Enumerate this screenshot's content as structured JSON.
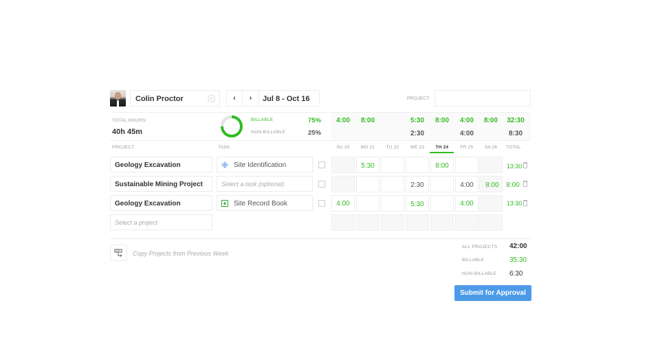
{
  "user": {
    "name": "Colin Proctor"
  },
  "date_range": {
    "label": "Jul 8 - Oct 16"
  },
  "project_filter": {
    "label": "PROJECT:",
    "value": ""
  },
  "summary": {
    "total_hours_label": "TOTAL HOURS:",
    "total_hours": "40h 45m",
    "billable_label": "BILLABLE",
    "billable_pct": "75%",
    "nonbillable_label": "NON-BILLABLE",
    "nonbillable_pct": "25%",
    "billable_fraction": 0.75,
    "billable_row": [
      "4:00",
      "8:00",
      "",
      "5:30",
      "8:00",
      "4:00",
      "8:00",
      "32:30"
    ],
    "nonbillable_row": [
      "",
      "",
      "",
      "2:30",
      "",
      "4:00",
      "",
      "8:30"
    ]
  },
  "columns": {
    "project": "PROJECT",
    "task": "TASK",
    "days": [
      "SU 20",
      "MO 21",
      "TU 22",
      "WE 23",
      "TH 24",
      "FR 25",
      "SA 26"
    ],
    "total": "TOTAL"
  },
  "rows": [
    {
      "project": "Geology Excavation",
      "task": "Site Identification",
      "task_icon": "diamond-icon",
      "hours": [
        "",
        "5:30",
        "",
        "",
        "8:00",
        "",
        ""
      ],
      "total": "13:30"
    },
    {
      "project": "Sustainable Mining Project",
      "task": "",
      "task_placeholder": "Select a task (optional)",
      "hours": [
        "",
        "",
        "",
        "2:30",
        "",
        "4:00",
        "8:00"
      ],
      "total": "8:00"
    },
    {
      "project": "Geology Excavation",
      "task": "Site Record Book",
      "task_icon": "star-box-icon",
      "hours": [
        "4:00",
        "",
        "",
        "5:30",
        "",
        "4:00",
        ""
      ],
      "total": "13:30"
    }
  ],
  "new_row": {
    "project_placeholder": "Select a project"
  },
  "copy_projects": {
    "label": "Copy Projects from Previous Week"
  },
  "totals": {
    "all_label": "ALL PROJECTS",
    "all_value": "42:00",
    "billable_label": "BILLABLE",
    "billable_value": "35:30",
    "nonbillable_label": "NON-BILLABLE",
    "nonbillable_value": "6:30"
  },
  "submit": {
    "label": "Submit for Approval"
  },
  "colors": {
    "accent_green": "#33bb22",
    "primary_blue": "#4d9be8",
    "today_underline": "#33bb22"
  }
}
